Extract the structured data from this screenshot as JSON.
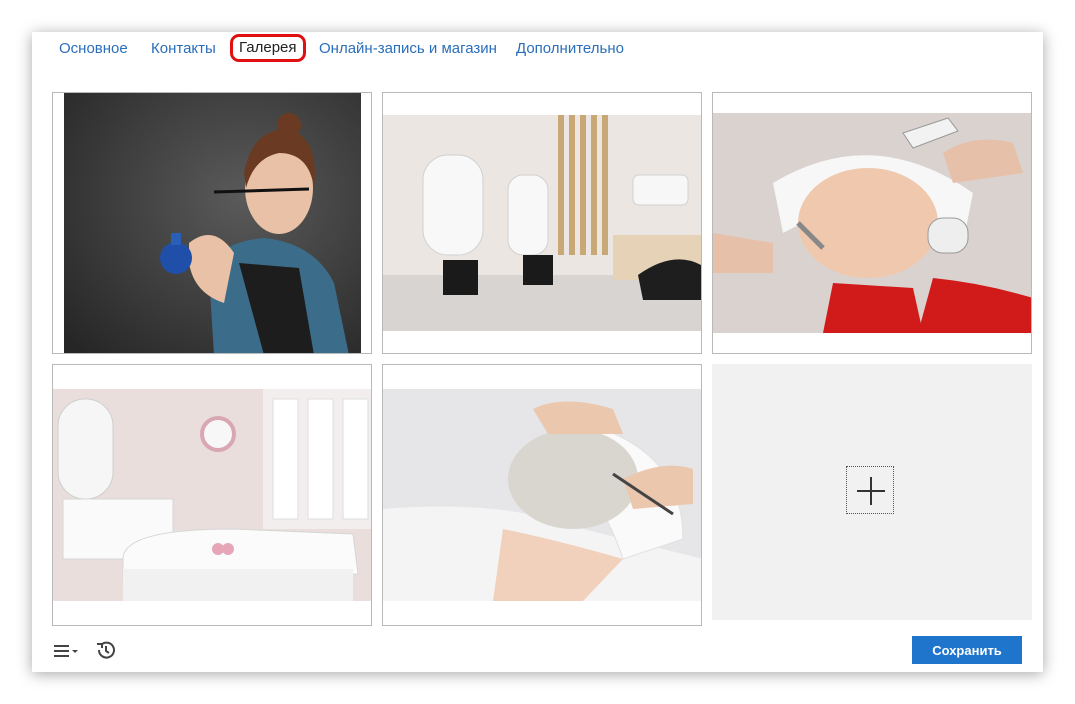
{
  "tabs": [
    {
      "label": "Основное",
      "active": false
    },
    {
      "label": "Контакты",
      "active": false
    },
    {
      "label": "Галерея",
      "active": true
    },
    {
      "label": "Онлайн-запись и магазин",
      "active": false
    },
    {
      "label": "Дополнительно",
      "active": false
    }
  ],
  "gallery": {
    "images": [
      {
        "icon": "photo-hairdresser"
      },
      {
        "icon": "photo-salon-interior"
      },
      {
        "icon": "photo-facial-procedure"
      },
      {
        "icon": "photo-cosmetology-room"
      },
      {
        "icon": "photo-face-mask"
      }
    ],
    "add_icon": "plus-icon"
  },
  "toolbar": {
    "menu_icon": "menu-icon",
    "history_icon": "history-icon",
    "save_label": "Сохранить"
  },
  "colors": {
    "accent": "#1f74cc",
    "tab_link": "#2a6ebb",
    "highlight": "#e01010"
  }
}
